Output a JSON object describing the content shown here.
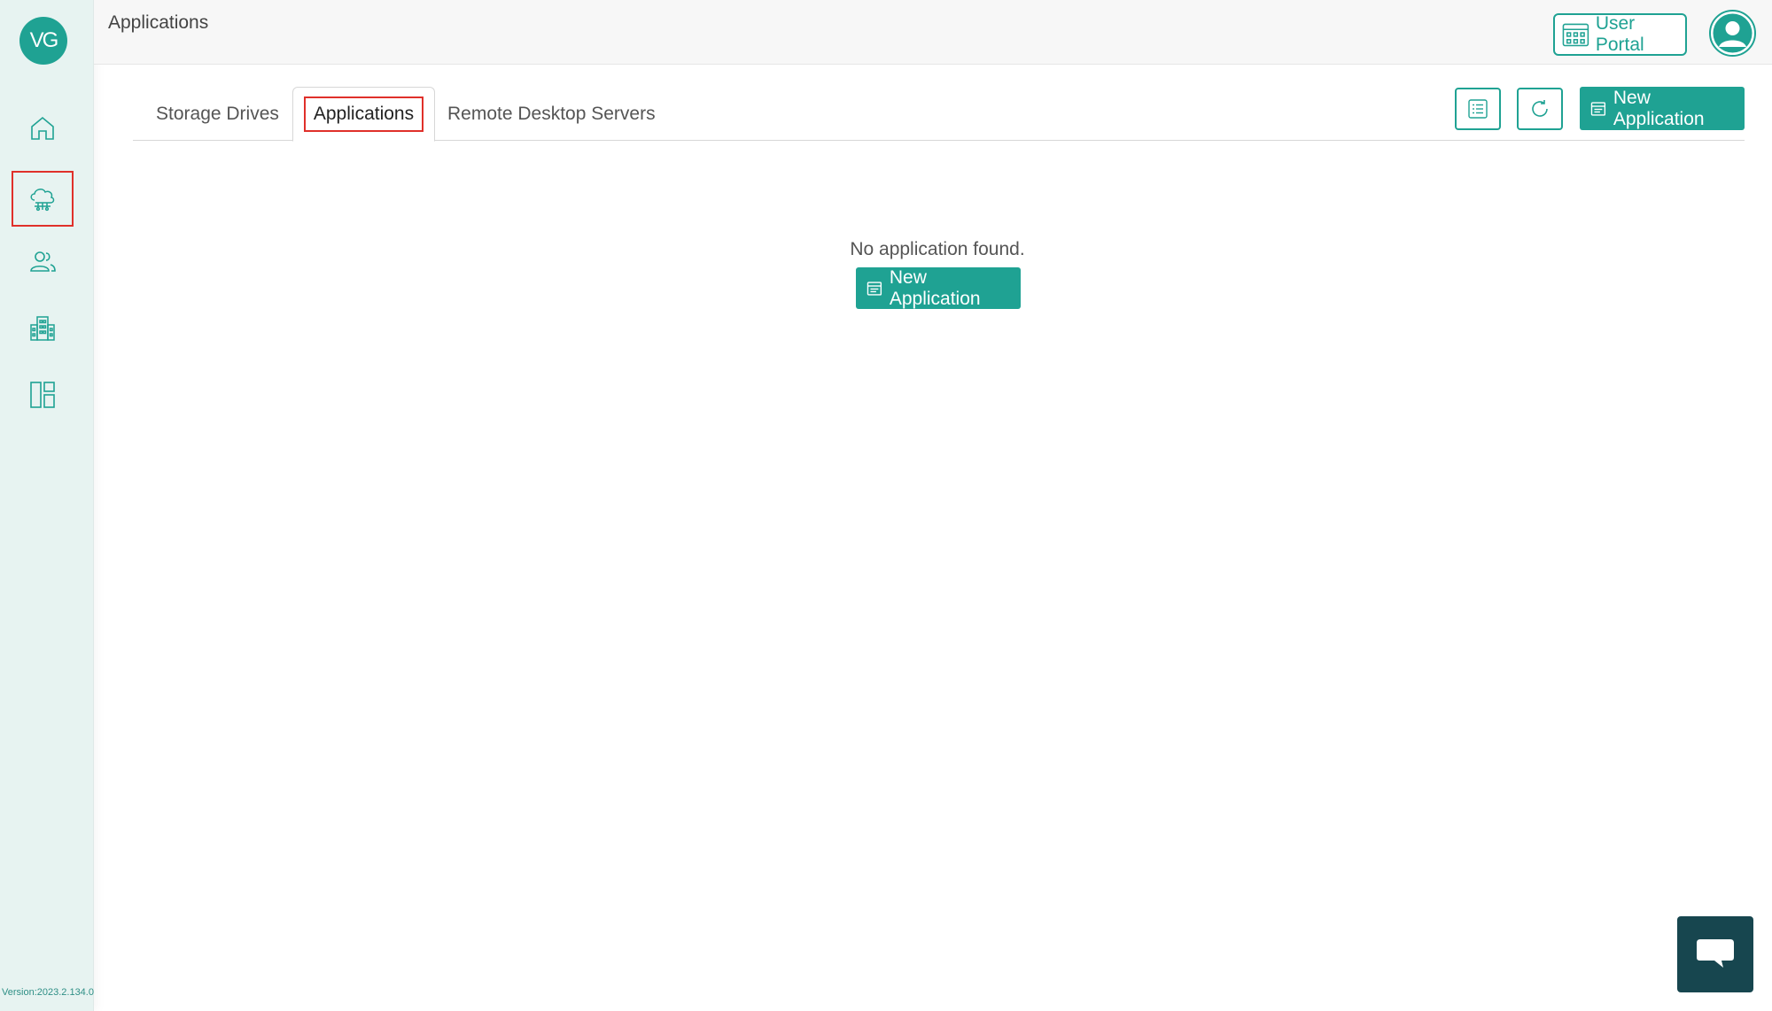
{
  "sidebar": {
    "logo_text": "VG",
    "items": [
      {
        "name": "home",
        "icon": "home-icon"
      },
      {
        "name": "cloud-network",
        "icon": "cloud-network-icon",
        "active": true
      },
      {
        "name": "users",
        "icon": "users-icon"
      },
      {
        "name": "organization",
        "icon": "building-icon"
      },
      {
        "name": "dashboard",
        "icon": "layout-icon"
      }
    ],
    "version": "Version:2023.2.134.0"
  },
  "header": {
    "title": "Applications",
    "user_portal_label": "User Portal",
    "avatar_icon": "user-avatar-icon"
  },
  "tabs": [
    {
      "label": "Storage Drives",
      "active": false
    },
    {
      "label": "Applications",
      "active": true
    },
    {
      "label": "Remote Desktop Servers",
      "active": false
    }
  ],
  "toolbar": {
    "list_icon": "list-view-icon",
    "refresh_icon": "refresh-icon",
    "new_application_label": "New Application"
  },
  "empty_state": {
    "message": "No application found.",
    "button_label": "New Application"
  },
  "chat": {
    "icon": "chat-bubble-icon"
  },
  "colors": {
    "accent": "#1fa293",
    "sidebar_bg": "#e7f3f1",
    "chat_bg": "#17464f",
    "highlight": "#e0302a"
  }
}
